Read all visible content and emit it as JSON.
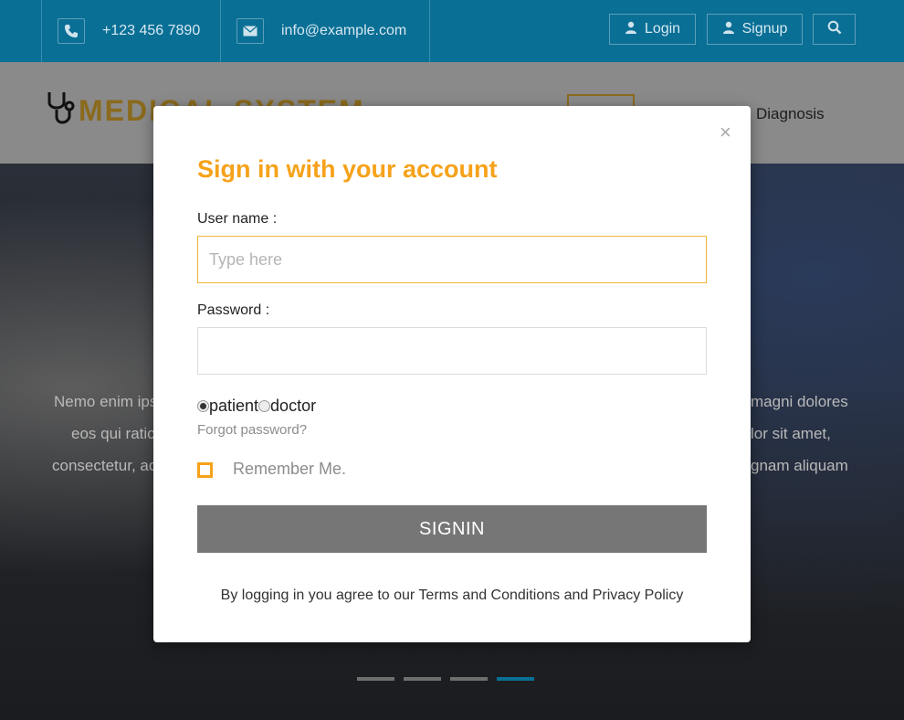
{
  "topbar": {
    "phone": "+123 456 7890",
    "email": "info@example.com",
    "login_label": "Login",
    "signup_label": "Signup",
    "icons": [
      "phone-icon",
      "mail-icon",
      "user-icon",
      "search-icon"
    ]
  },
  "header": {
    "logo_text": "MEDICAL SYSTEM",
    "nav_diagnosis": "Diagnosis"
  },
  "hero": {
    "lines_left": [
      "Nemo enim ips",
      "eos qui ratic",
      "consectetur, ac"
    ],
    "lines_right": [
      "magni dolores",
      "lor sit amet,",
      "gnam aliquam"
    ],
    "slider_active_index": 3,
    "slider_count": 4
  },
  "modal": {
    "close_symbol": "×",
    "title": "Sign in with your account",
    "username_label": "User name :",
    "username_placeholder": "Type here",
    "password_label": "Password :",
    "radio_patient": "patient",
    "radio_doctor": "doctor",
    "forgot_link": "Forgot password?",
    "remember_label": "Remember Me.",
    "signin_button": "SIGNIN",
    "agree_text": "By logging in you agree to our Terms and Conditions and Privacy Policy"
  },
  "colors": {
    "topbar": "#0a6f95",
    "accent": "#f6a21a",
    "button": "#767676"
  }
}
